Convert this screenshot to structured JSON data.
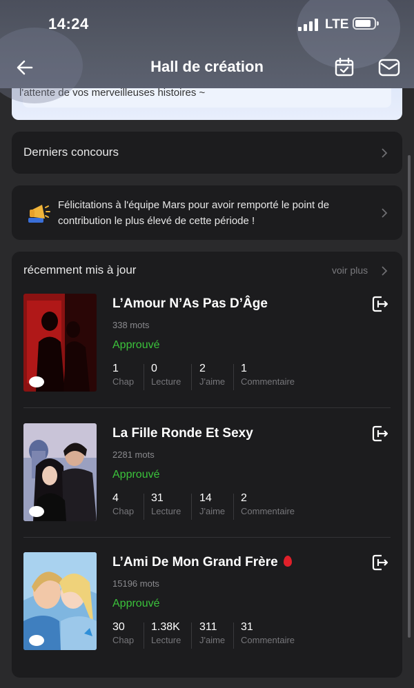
{
  "status_bar": {
    "time": "14:24",
    "network": "LTE"
  },
  "nav": {
    "title": "Hall de création"
  },
  "banner": {
    "text": "l'attente de vos merveilleuses histoires ~"
  },
  "contests": {
    "label": "Derniers concours"
  },
  "notice": {
    "text": "Félicitations à l'équipe Mars pour avoir remporté le point de contribution le plus élevé de cette période !"
  },
  "recent": {
    "heading": "récemment mis à jour",
    "more_label": "voir plus",
    "books": [
      {
        "title": "L’Amour N’As Pas D’Âge",
        "words": "338 mots",
        "status": "Approuvé",
        "stats": [
          {
            "value": "1",
            "label": "Chap"
          },
          {
            "value": "0",
            "label": "Lecture"
          },
          {
            "value": "2",
            "label": "J'aime"
          },
          {
            "value": "1",
            "label": "Commentaire"
          }
        ]
      },
      {
        "title": "La Fille Ronde Et Sexy",
        "words": "2281 mots",
        "status": "Approuvé",
        "stats": [
          {
            "value": "4",
            "label": "Chap"
          },
          {
            "value": "31",
            "label": "Lecture"
          },
          {
            "value": "14",
            "label": "J'aime"
          },
          {
            "value": "2",
            "label": "Commentaire"
          }
        ]
      },
      {
        "title": "L’Ami De Mon Grand Frère",
        "words": "15196 mots",
        "status": "Approuvé",
        "stats": [
          {
            "value": "30",
            "label": "Chap"
          },
          {
            "value": "1.38K",
            "label": "Lecture"
          },
          {
            "value": "311",
            "label": "J'aime"
          },
          {
            "value": "31",
            "label": "Commentaire"
          }
        ]
      }
    ]
  },
  "colors": {
    "approved": "#3bc33b",
    "card_bg": "#1c1c1e",
    "page_bg": "#2a2a2c"
  }
}
